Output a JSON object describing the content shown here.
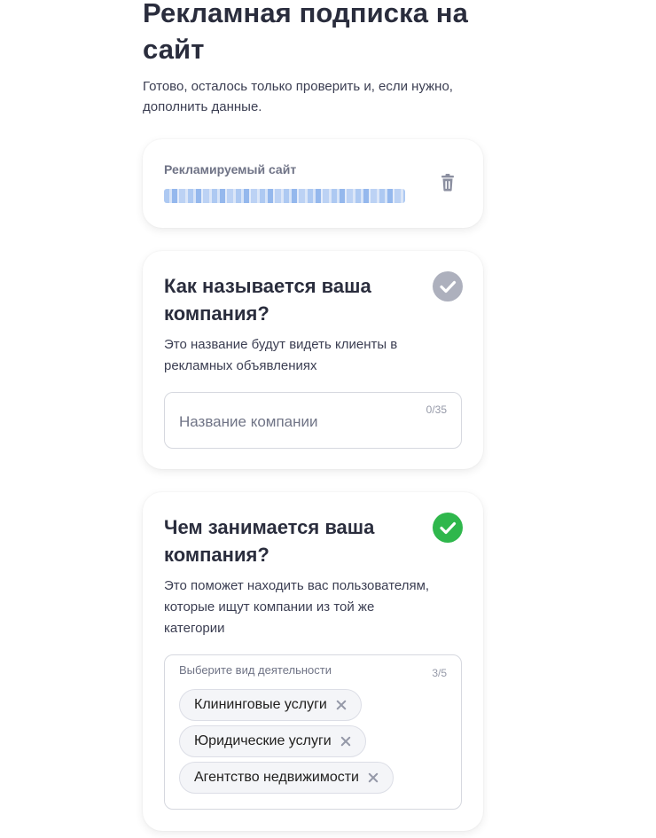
{
  "header": {
    "title": "Рекламная подписка на сайт",
    "subtitle": "Готово, осталось только проверить и, если нужно, дополнить данные."
  },
  "site_card": {
    "label": "Рекламируемый сайт",
    "delete_icon": "trash-icon"
  },
  "company_name_card": {
    "title": "Как называется ваша компания?",
    "description": "Это название будут видеть клиенты в рекламных объявлениях",
    "status_icon": "check-circle-icon",
    "status_color": "#adb0bd",
    "input": {
      "value": "",
      "placeholder": "Название компании",
      "counter": "0/35"
    }
  },
  "activity_card": {
    "title": "Чем занимается ваша компания?",
    "description": "Это поможет находить вас пользователям, которые ищут компании из той же категории",
    "status_icon": "check-circle-icon",
    "status_color": "#2fb74c",
    "select": {
      "label": "Выберите вид деятельности",
      "counter": "3/5",
      "chips": [
        {
          "label": "Клининговые услуги"
        },
        {
          "label": "Юридические услуги"
        },
        {
          "label": "Агентство недвижимости"
        }
      ]
    }
  }
}
